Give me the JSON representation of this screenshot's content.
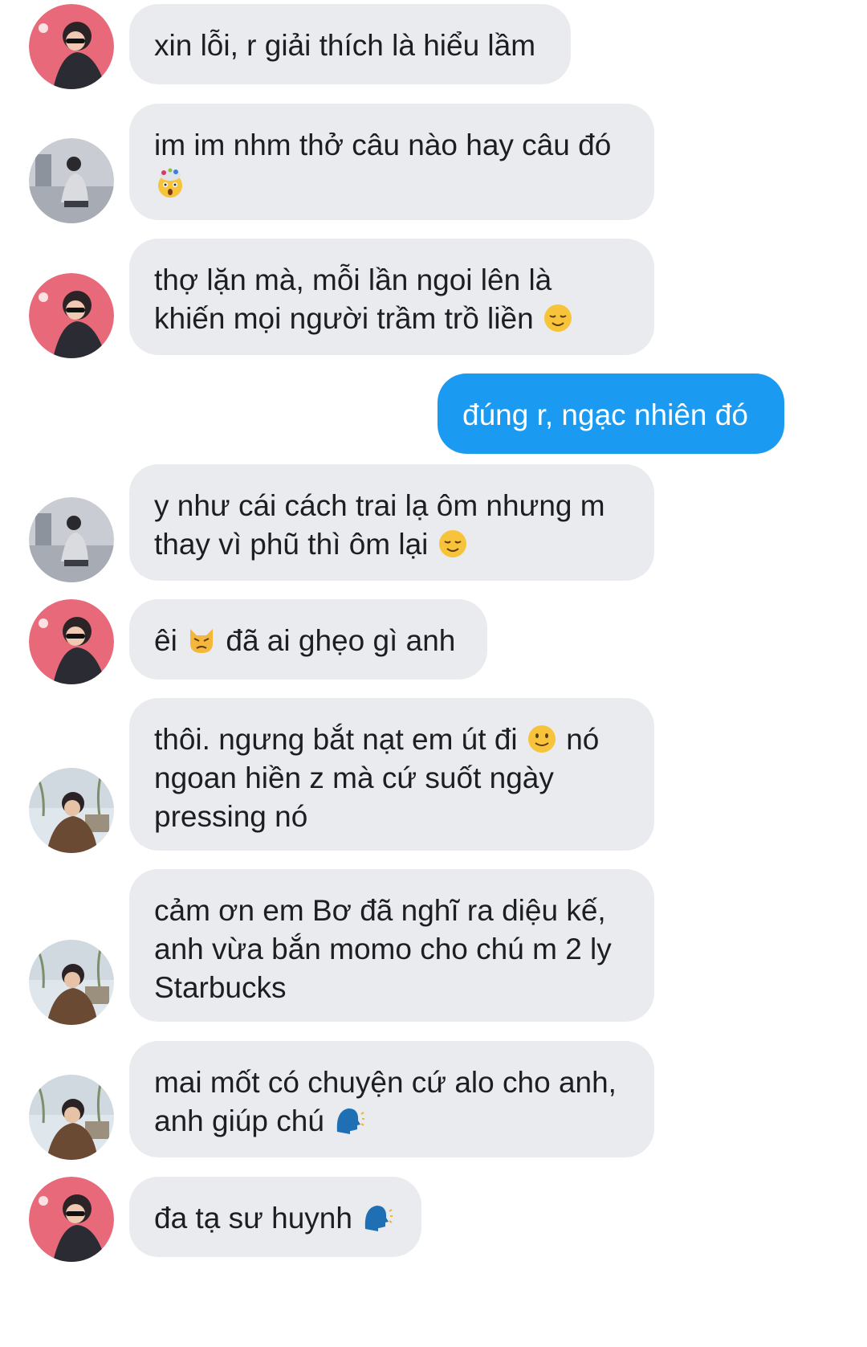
{
  "conversation": {
    "messages": [
      {
        "sender": "pink-avatar-user",
        "text": "xin lỗi, r giải thích là hiểu lầm"
      },
      {
        "sender": "gray-avatar-user",
        "text": "im im nhm thở câu nào hay câu đó",
        "emoji": "exploding-head-icon"
      },
      {
        "sender": "pink-avatar-user",
        "text": "thợ lặn mà, mỗi lần ngoi lên là khiến mọi người trầm trồ liền",
        "emoji": "relieved-face-icon"
      },
      {
        "sender": "me",
        "text": "đúng r, ngạc nhiên đó"
      },
      {
        "sender": "gray-avatar-user",
        "text": "y như cái cách trai lạ ôm nhưng m thay vì phũ thì ôm lại",
        "emoji": "relieved-face-icon"
      },
      {
        "sender": "pink-avatar-user",
        "text_before": "êi",
        "text": "đã ai ghẹo gì anh",
        "emoji": "pouting-cat-icon"
      },
      {
        "sender": "outdoor-avatar-user",
        "text_before": "thôi. ngưng bắt nạt em út đi",
        "text": "nó ngoan hiền z mà cứ suốt ngày pressing nó",
        "emoji": "slightly-smiling-face-icon"
      },
      {
        "sender": "outdoor-avatar-user",
        "text": "cảm ơn em Bơ đã nghĩ ra diệu kế, anh vừa bắn momo cho chú m 2 ly Starbucks"
      },
      {
        "sender": "outdoor-avatar-user",
        "text": "mai mốt có chuyện cứ alo cho anh, anh giúp chú",
        "emoji": "speaking-head-icon"
      },
      {
        "sender": "pink-avatar-user",
        "text": "đa tạ sư huynh",
        "emoji": "speaking-head-icon"
      }
    ]
  },
  "colors": {
    "incoming_bubble": "#e9ebef",
    "outgoing_bubble": "#1b9af1",
    "background": "#ffffff"
  }
}
